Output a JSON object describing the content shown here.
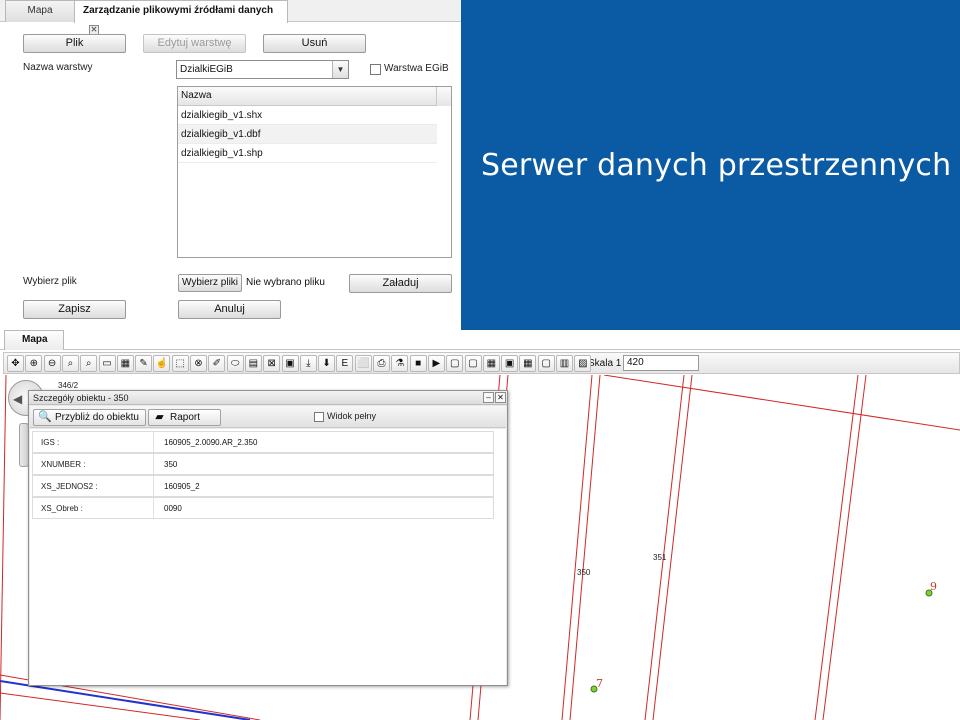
{
  "top_panel": {
    "tabs": [
      {
        "label": "Mapa"
      },
      {
        "label": "Zarządzanie plikowymi źródłami danych"
      }
    ],
    "buttons": {
      "file": "Plik",
      "edit_layer": "Edytuj warstwę",
      "delete": "Usuń",
      "choose_file": "Wybierz pliki",
      "upload": "Załaduj",
      "save": "Zapisz",
      "cancel": "Anuluj"
    },
    "layer_name_label": "Nazwa warstwy",
    "layer_select_value": "DzialkiEGiB",
    "egib_checkbox_label": "Warstwa EGiB",
    "grid": {
      "header": "Nazwa",
      "rows": [
        "dzialkiegib_v1.shx",
        "dzialkiegib_v1.dbf",
        "dzialkiegib_v1.shp"
      ]
    },
    "choose_file_label": "Wybierz plik",
    "no_file_text": "Nie wybrano pliku"
  },
  "title_panel": {
    "title": "Serwer danych przestrzennych",
    "background_color": "#0a5aa4"
  },
  "map_panel": {
    "tab_label": "Mapa",
    "scale_label": "Skala 1 :",
    "scale_value": "420",
    "toolbar_icons": [
      "pan-icon",
      "zoom-in-icon",
      "zoom-out-icon",
      "zoom-region-icon",
      "zoom-extent-icon",
      "measure-distance-icon",
      "layers-icon",
      "pencil-icon",
      "select-icon",
      "clear-selection-icon",
      "identify-icon",
      "eraser-icon",
      "highlight-icon",
      "add-feature-icon",
      "delete-feature-icon",
      "add-layer-icon",
      "export-icon",
      "download-icon",
      "edit-text-icon",
      "properties-icon",
      "print-icon",
      "flask-icon",
      "camera-icon",
      "movie-icon",
      "document-icon",
      "copy-icon",
      "table-icon",
      "chart-icon",
      "calculator-icon",
      "report-icon",
      "legend-icon",
      "tooltip-icon"
    ],
    "labels": {
      "parcel_346": "346/2",
      "parcel_350": "350",
      "parcel_351": "351",
      "point_9": "9",
      "point_7": "7"
    }
  },
  "details_window": {
    "title": "Szczegóły obiektu - 350",
    "zoom_button": "Przybliż do obiektu",
    "report_button": "Raport",
    "full_view_label": "Widok pełny",
    "attributes": [
      {
        "key": "IGS :",
        "value": "160905_2.0090.AR_2.350"
      },
      {
        "key": "XNUMBER :",
        "value": "350"
      },
      {
        "key": "XS_JEDNOS2 :",
        "value": "160905_2"
      },
      {
        "key": "XS_Obreb :",
        "value": "0090"
      }
    ]
  }
}
